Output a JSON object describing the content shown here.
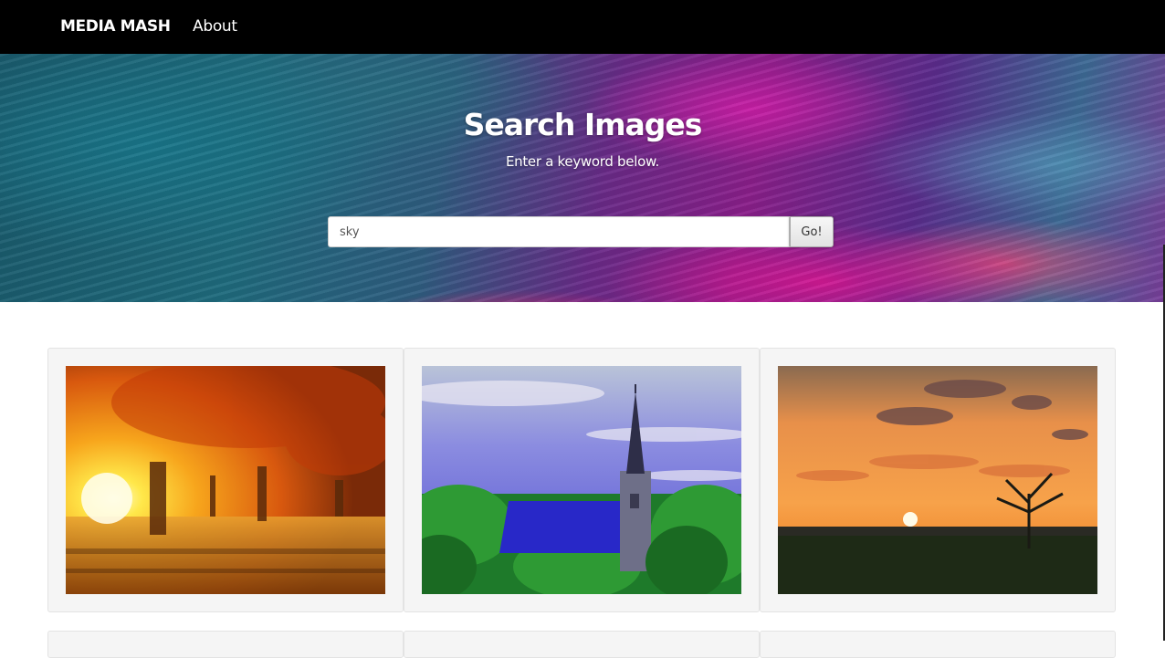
{
  "navbar": {
    "brand": "MEDIA MASH",
    "about_label": "About"
  },
  "hero": {
    "title": "Search Images",
    "subtitle": "Enter a keyword below.",
    "search_value": "sky",
    "search_button_label": "Go!"
  },
  "results": [
    {
      "name": "autumn-forest-photo",
      "description": "sunlit autumn forest"
    },
    {
      "name": "church-spire-photo",
      "description": "church with spire under sky"
    },
    {
      "name": "sunset-tree-photo",
      "description": "sunset with lone tree"
    }
  ],
  "colors": {
    "navbar_bg": "#000000",
    "card_bg": "#f5f5f5"
  }
}
